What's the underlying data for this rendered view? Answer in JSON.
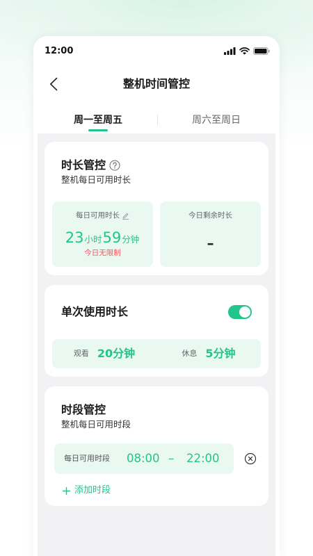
{
  "status_bar": {
    "time": "12:00",
    "icons": [
      "signal-icon",
      "wifi-icon",
      "battery-icon"
    ]
  },
  "header": {
    "back_icon": "chevron-left-icon",
    "title": "整机时间管控"
  },
  "tabs": [
    {
      "label": "周一至周五",
      "active": true
    },
    {
      "label": "周六至周日",
      "active": false
    }
  ],
  "duration_card": {
    "title": "时长管控",
    "help_icon": "question-circle-icon",
    "subtitle": "整机每日可用时长",
    "daily": {
      "label": "每日可用时长",
      "edit_icon": "pencil-icon",
      "hours": "23",
      "hours_unit": "小时",
      "minutes": "59",
      "minutes_unit": "分钟",
      "note": "今日无限制"
    },
    "remaining": {
      "label": "今日剩余时长",
      "value": "–"
    }
  },
  "single_use_card": {
    "title": "单次使用时长",
    "enabled": true,
    "watch": {
      "label": "观看",
      "value": "20分钟"
    },
    "rest": {
      "label": "休息",
      "value": "5分钟"
    }
  },
  "period_card": {
    "title": "时段管控",
    "subtitle": "整机每日可用时段",
    "periods": [
      {
        "label": "每日可用时段",
        "start": "08:00",
        "separator": "–",
        "end": "22:00",
        "remove_icon": "close-circle-icon"
      }
    ],
    "add_icon": "plus-icon",
    "add_label": "添加时段"
  },
  "colors": {
    "accent": "#21c58a",
    "accent_bg": "#eaf8f2",
    "warning": "#f4555a",
    "page_bg": "#f2f2f5",
    "text": "#1a1a1a"
  }
}
